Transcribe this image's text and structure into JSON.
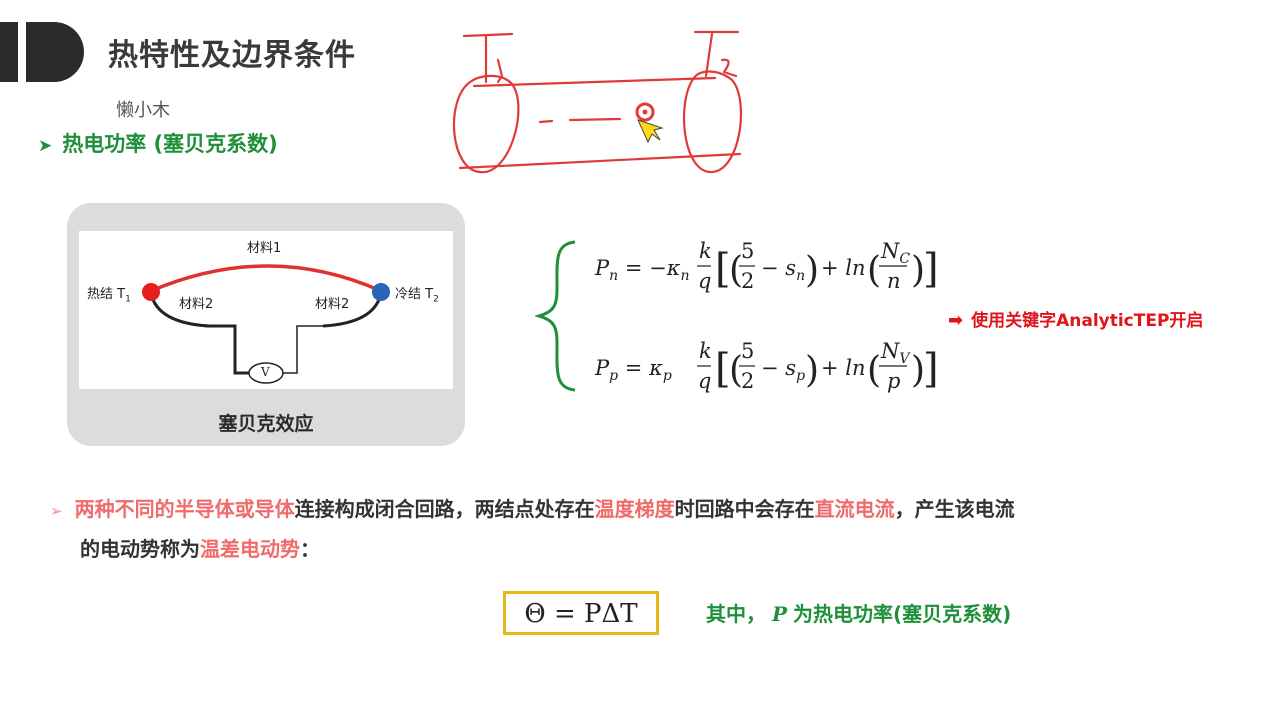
{
  "header": {
    "title": "热特性及边界条件",
    "watermark": "懒小木"
  },
  "section": {
    "heading": "热电功率 (塞贝克系数)"
  },
  "diagram": {
    "material1": "材料1",
    "material2_left": "材料2",
    "material2_right": "材料2",
    "hot_junction": "热结 T",
    "hot_sub": "1",
    "cold_junction": "冷结 T",
    "cold_sub": "2",
    "voltmeter": "V",
    "caption": "塞贝克效应",
    "colors": {
      "hot": "#e81d1d",
      "cold": "#2a63b8",
      "material1_wire": "#e03030"
    }
  },
  "formulas": {
    "note": "使用关键字AnalyticTEP开启"
  },
  "paragraph": {
    "p1": "两种不同的半导体或导体",
    "p2": "连接构成闭合回路，两结点处存在",
    "p3": "温度梯度",
    "p4": "时回路中会存在",
    "p5": "直流电流",
    "p6": "，产生该电流",
    "p7": "的电动势称为",
    "p8": "温差电动势",
    "p9": "："
  },
  "equation": {
    "text": "Θ = PΔT",
    "note_prefix": "其中，",
    "note_var": "P",
    "note_suffix": "为热电功率(塞贝克系数)"
  },
  "colors": {
    "accent_green": "#1f8f3a",
    "highlight_red": "#f06b6b",
    "note_red": "#e0141b",
    "box_border": "#e8b717"
  }
}
